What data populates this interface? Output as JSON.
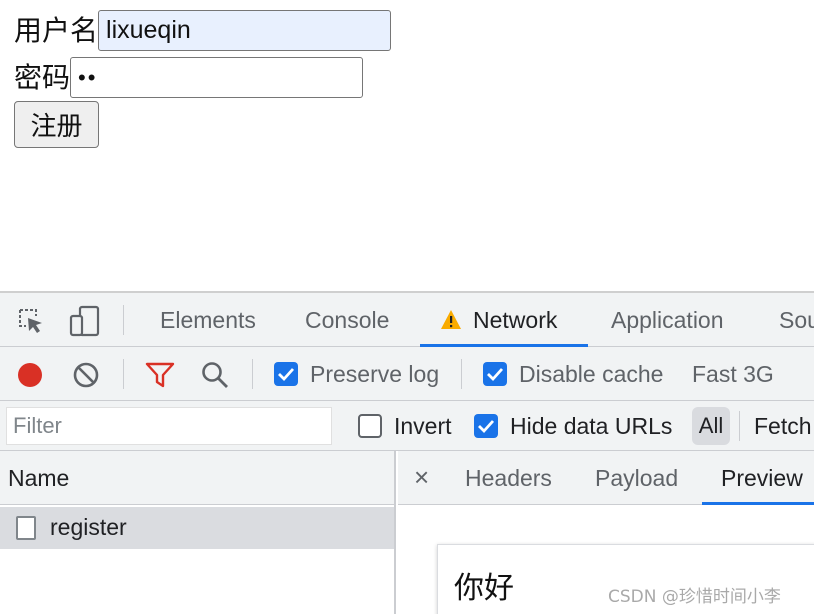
{
  "form": {
    "username_label": "用户名",
    "username_value": "lixueqin",
    "password_label": "密码",
    "password_value": "••",
    "register_button": "注册"
  },
  "devtools": {
    "tabs": [
      {
        "label": "Elements"
      },
      {
        "label": "Console"
      },
      {
        "label": "Network",
        "active": true,
        "warning_icon": "warning-triangle-icon"
      },
      {
        "label": "Application"
      },
      {
        "label": "Sou"
      }
    ],
    "toolbar": {
      "preserve_log_label": "Preserve log",
      "preserve_log_checked": true,
      "disable_cache_label": "Disable cache",
      "disable_cache_checked": true,
      "throttling": "Fast 3G"
    },
    "filterbar": {
      "filter_placeholder": "Filter",
      "invert_label": "Invert",
      "invert_checked": false,
      "hide_data_urls_label": "Hide data URLs",
      "hide_data_urls_checked": true,
      "type_all": "All",
      "type_fetch": "Fetch"
    },
    "request_list": {
      "column_name": "Name",
      "rows": [
        {
          "name": "register"
        }
      ]
    },
    "detail": {
      "close_symbol": "×",
      "tabs": [
        {
          "label": "Headers"
        },
        {
          "label": "Payload"
        },
        {
          "label": "Preview",
          "active": true
        }
      ],
      "preview_text": "你好"
    },
    "colors": {
      "accent": "#1a73e8",
      "record": "#d93025",
      "filter_icon": "#d93025",
      "warning": "#f9ab00"
    }
  },
  "watermark": "CSDN @珍惜时间小李"
}
